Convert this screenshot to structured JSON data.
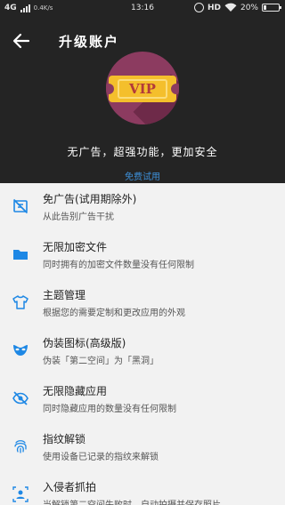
{
  "status_bar": {
    "network": "4G",
    "speed": "0.4K/s",
    "time": "13:16",
    "hd": "HD",
    "battery_percent": "20%",
    "battery_level": 0.2
  },
  "app_bar": {
    "back_icon": "arrow-left-icon",
    "title": "升级账户"
  },
  "hero": {
    "badge_text": "VIP",
    "tagline": "无广告，超强功能，更加安全",
    "trial_link": "免费试用"
  },
  "colors": {
    "header_bg": "#242424",
    "badge_bg": "#8c3b60",
    "ticket": "#f4bf2c",
    "accent": "#3d8fd8",
    "icon": "#1e88e5"
  },
  "features": [
    {
      "icon": "no-ads-icon",
      "title": "免广告(试用期除外)",
      "subtitle": "从此告别广告干扰"
    },
    {
      "icon": "folder-icon",
      "title": "无限加密文件",
      "subtitle": "同时拥有的加密文件数量没有任何限制"
    },
    {
      "icon": "shirt-icon",
      "title": "主题管理",
      "subtitle": "根据您的需要定制和更改应用的外观"
    },
    {
      "icon": "mask-icon",
      "title": "伪装图标(高级版)",
      "subtitle": "伪装「第二空间」为「黑洞」"
    },
    {
      "icon": "eye-off-icon",
      "title": "无限隐藏应用",
      "subtitle": "同时隐藏应用的数量没有任何限制"
    },
    {
      "icon": "fingerprint-icon",
      "title": "指纹解锁",
      "subtitle": "使用设备已记录的指纹来解锁"
    },
    {
      "icon": "camera-icon",
      "title": "入侵者抓拍",
      "subtitle": "当解锁第二空间失败时，自动拍摄并保存照片"
    }
  ]
}
